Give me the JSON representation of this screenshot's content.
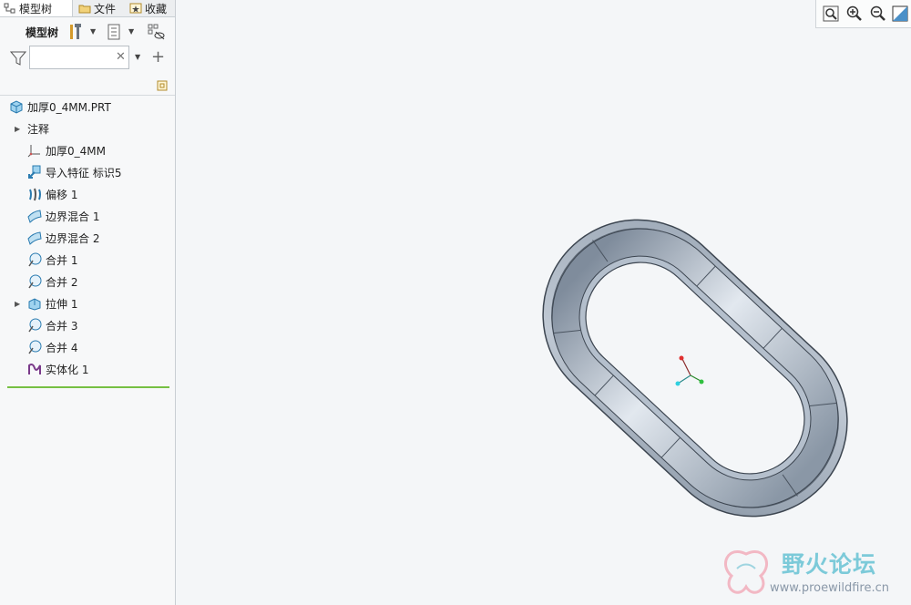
{
  "tabs": [
    {
      "label": "模型树",
      "icon": "model-tree-icon"
    },
    {
      "label": "文件",
      "icon": "folder-icon"
    },
    {
      "label": "收藏",
      "icon": "favorites-icon"
    }
  ],
  "toolbar": {
    "label": "模型树",
    "buttons": [
      "tools-icon",
      "show-icon",
      "visibility-icon"
    ]
  },
  "filter": {
    "value": "",
    "placeholder": ""
  },
  "tree": {
    "root": "加厚0_4MM.PRT",
    "items": [
      {
        "label": "注释",
        "icon": "annotation-icon",
        "expandable": true
      },
      {
        "label": "加厚0_4MM",
        "icon": "csys-icon",
        "expandable": false
      },
      {
        "label": "导入特征 标识5",
        "icon": "import-feature-icon",
        "expandable": false
      },
      {
        "label": "偏移 1",
        "icon": "offset-icon",
        "expandable": false
      },
      {
        "label": "边界混合 1",
        "icon": "boundary-blend-icon",
        "expandable": false
      },
      {
        "label": "边界混合 2",
        "icon": "boundary-blend-icon",
        "expandable": false
      },
      {
        "label": "合并 1",
        "icon": "merge-icon",
        "expandable": false
      },
      {
        "label": "合并 2",
        "icon": "merge-icon",
        "expandable": false
      },
      {
        "label": "拉伸 1",
        "icon": "extrude-icon",
        "expandable": true
      },
      {
        "label": "合并 3",
        "icon": "merge-icon",
        "expandable": false
      },
      {
        "label": "合并 4",
        "icon": "merge-icon",
        "expandable": false
      },
      {
        "label": "实体化 1",
        "icon": "solidify-icon",
        "expandable": false
      }
    ]
  },
  "view_toolbar": [
    "zoom-fit-icon",
    "zoom-in-icon",
    "zoom-out-icon",
    "view-orient-icon"
  ],
  "watermark": {
    "title": "野火论坛",
    "url": "www.proewildfire.cn"
  },
  "colors": {
    "part": "#b4bfcc",
    "insert_line": "#76c043",
    "accent": "#2b78c5"
  }
}
